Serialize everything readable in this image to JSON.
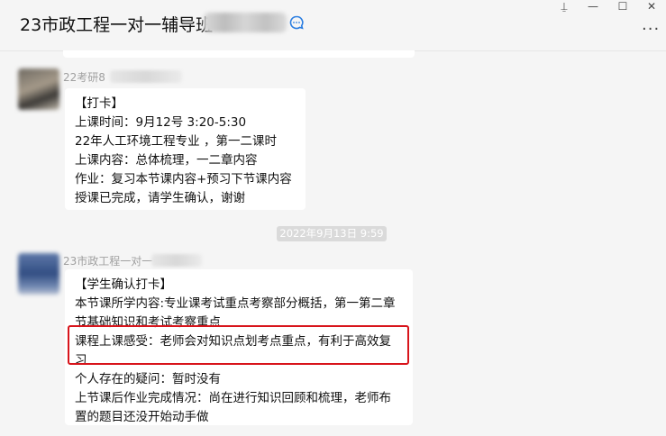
{
  "header": {
    "chat_title": "23市政工程一对一辅导班"
  },
  "window_controls": {
    "pin": "⍊",
    "minimize": "—",
    "maximize": "☐",
    "close": "✕",
    "more": "···"
  },
  "messages": [
    {
      "sender": "22考研8",
      "lines": [
        "【打卡】",
        "上课时间：9月12号 3:20-5:30",
        "22年人工环境工程专业 ，第一二课时",
        "上课内容：总体梳理，一二章内容",
        "作业：复习本节课内容+预习下节课内容",
        "授课已完成，请学生确认，谢谢"
      ]
    },
    {
      "sender": "23市政工程一对一",
      "lines": [
        "【学生确认打卡】",
        "本节课所学内容:专业课考试重点考察部分概括，第一第二章",
        "节基础知识和考试考察重点",
        "课程上课感受：老师会对知识点划考点重点，有利于高效复",
        "习",
        "个人存在的疑问：暂时没有",
        "上节课后作业完成情况：尚在进行知识回顾和梳理，老师布",
        "置的题目还没开始动手做"
      ]
    }
  ],
  "timestamp": "2022年9月13日 9:59",
  "colors": {
    "background": "#f5f5f5",
    "bubble": "#ffffff",
    "highlight_border": "#d8141b",
    "timestamp_badge": "#dadada"
  }
}
